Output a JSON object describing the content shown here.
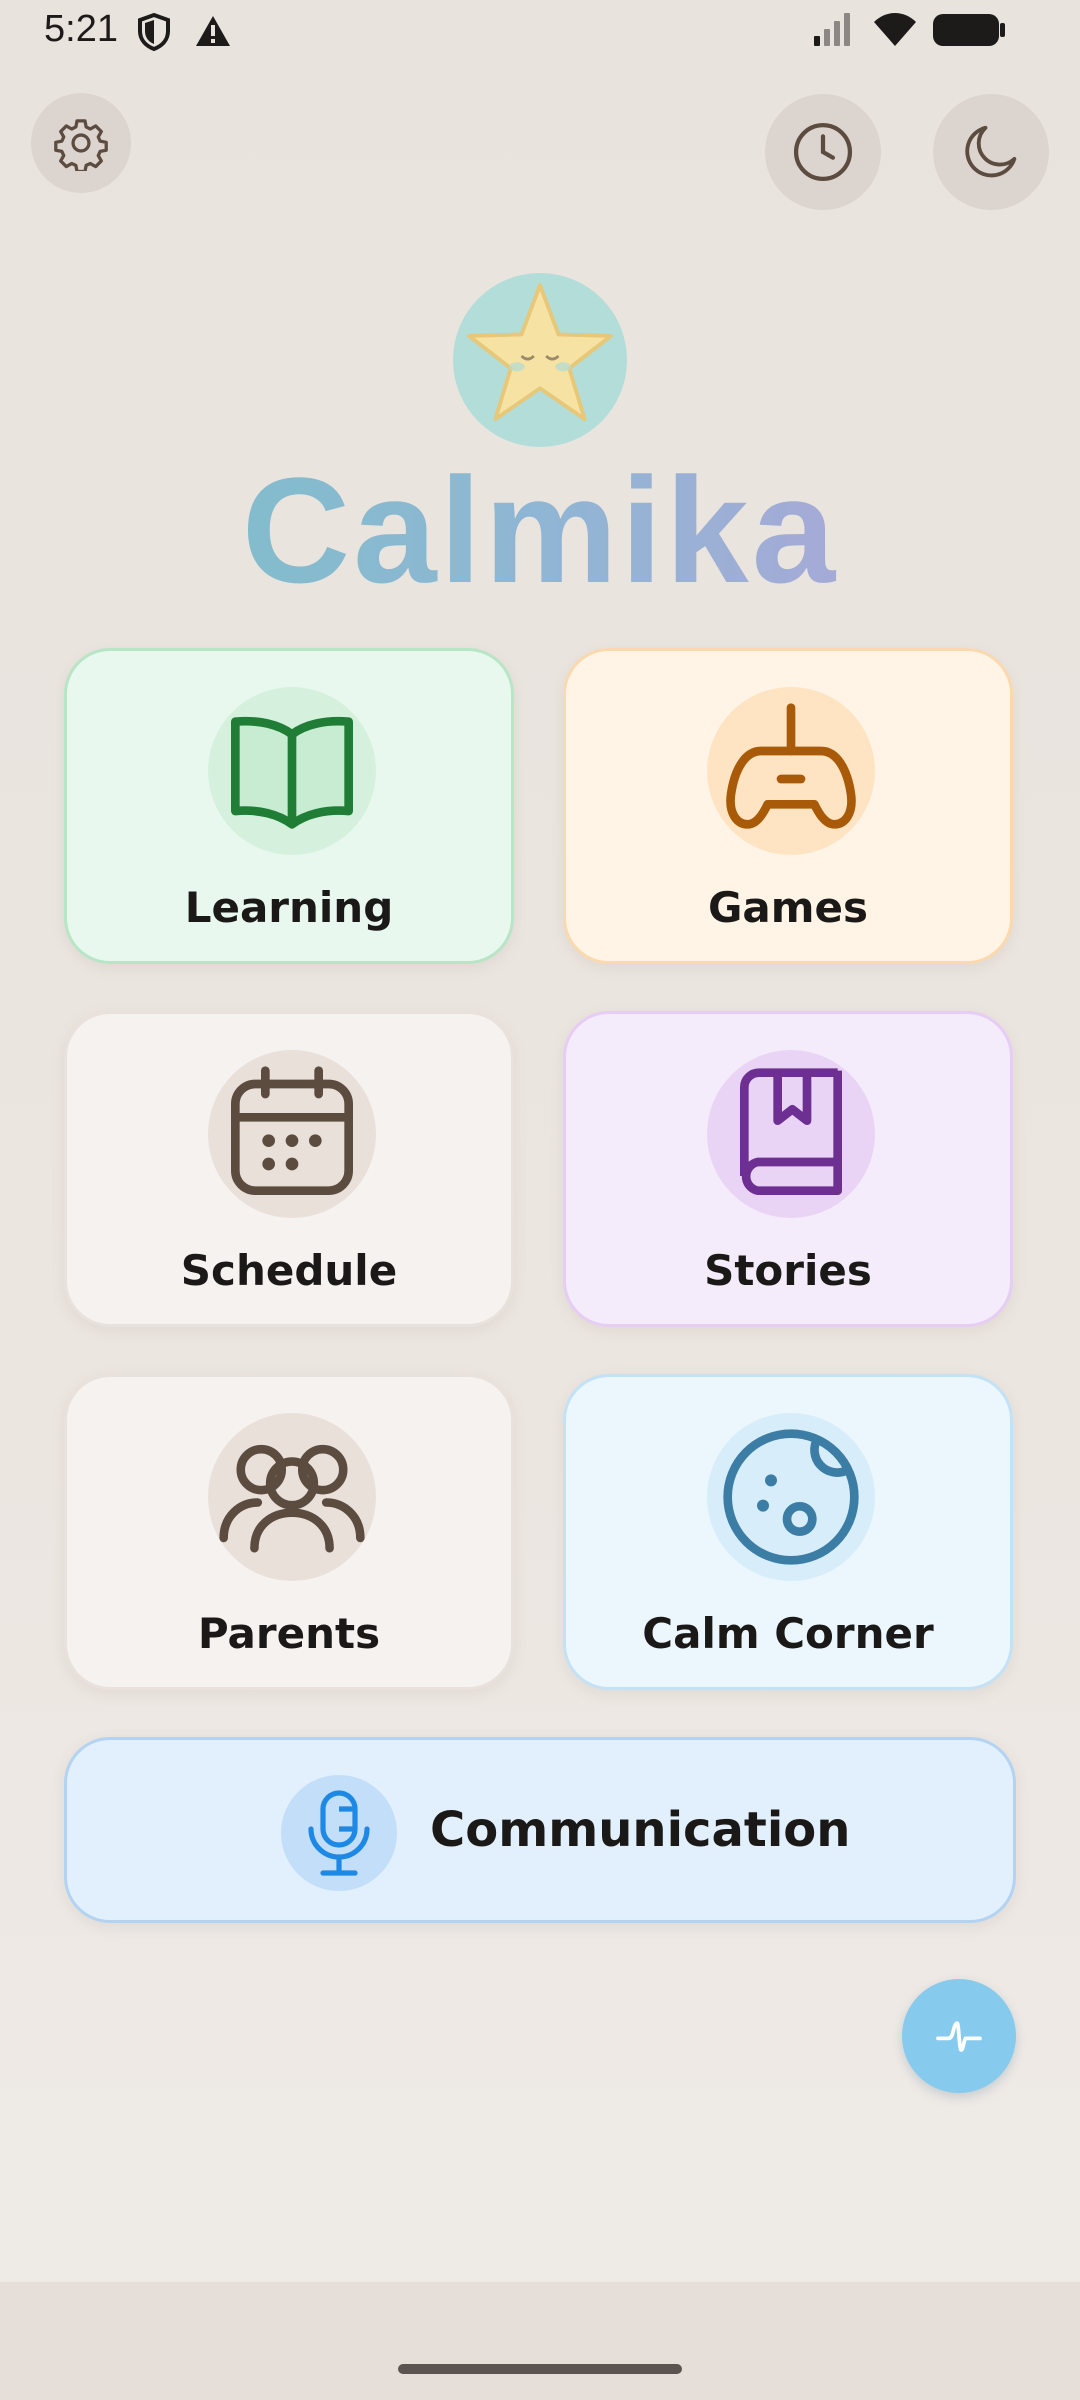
{
  "status_bar": {
    "time": "5:21",
    "icons": [
      "shield-icon",
      "warning-icon",
      "signal-icon",
      "wifi-icon",
      "battery-icon"
    ]
  },
  "top_bar": {
    "left_button_icon": "gear-icon",
    "right_buttons": [
      "clock-icon",
      "moon-icon"
    ]
  },
  "app": {
    "title": "Calmika",
    "logo_icon": "sleeping-star-icon",
    "title_gradient": [
      "#79c1c6",
      "#a7a9d6"
    ]
  },
  "cards": [
    {
      "label": "Learning",
      "icon": "open-book-icon",
      "accent": "#1f7d35"
    },
    {
      "label": "Games",
      "icon": "gamepad-icon",
      "accent": "#a85a08"
    },
    {
      "label": "Schedule",
      "icon": "calendar-icon",
      "accent": "#5c4b3f"
    },
    {
      "label": "Stories",
      "icon": "bookmarked-book-icon",
      "accent": "#6d2f91"
    },
    {
      "label": "Parents",
      "icon": "people-icon",
      "accent": "#5c4b3f"
    },
    {
      "label": "Calm Corner",
      "icon": "moon-planet-icon",
      "accent": "#3b7da4"
    }
  ],
  "communication": {
    "label": "Communication",
    "icon": "microphone-icon",
    "accent": "#1e88e5"
  },
  "fab": {
    "icon": "pulse-icon"
  }
}
